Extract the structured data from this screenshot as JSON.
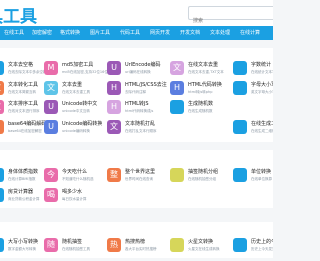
{
  "site": {
    "title": "具工具"
  },
  "search": {
    "placeholder": "搜索"
  },
  "nav": {
    "items": [
      "在线工具",
      "加密解密",
      "格式转换",
      "图片工具",
      "代码工具",
      "网页开发",
      "开发文档",
      "文本处理",
      "在线计算"
    ]
  },
  "sections": [
    {
      "title": "",
      "cards": [
        {
          "letter": "",
          "color": "#1ba0e2",
          "title": "文本去空格",
          "desc": "在线去除文本中多余空格"
        },
        {
          "letter": "M",
          "color": "#e96caa",
          "title": "md5加密工具",
          "desc": "md5在线加密,支持32位16位"
        },
        {
          "letter": "U",
          "color": "#9b59b6",
          "title": "UrlEncode编码",
          "desc": "url编码在线转换"
        },
        {
          "letter": "文",
          "color": "#d6a4e0",
          "title": "在线文本去重",
          "desc": "在线文本去重,TXT文本"
        },
        {
          "letter": "",
          "color": "#1ba0e2",
          "title": "字数统计",
          "desc": "在线统计文本字数"
        },
        {
          "letter": "文",
          "color": "#f07a48",
          "title": "文本转化工具",
          "desc": "在线文本简繁互转"
        },
        {
          "letter": "文",
          "color": "#5ec4e8",
          "title": "文本去重",
          "desc": "在线文本去重工具"
        },
        {
          "letter": "H",
          "color": "#9b59b6",
          "title": "HTML/JS/CSS去注",
          "desc": "去除代码注释"
        },
        {
          "letter": "H",
          "color": "#5b7ee0",
          "title": "HTML代码转换",
          "desc": "html转js转php"
        },
        {
          "letter": "",
          "color": "#1ba0e2",
          "title": "字母大小写转换",
          "desc": "英文字母大小写在线转换"
        },
        {
          "letter": "文",
          "color": "#e96caa",
          "title": "文本排序工具",
          "desc": "在线对文本进行排序"
        },
        {
          "letter": "U",
          "color": "#9b59b6",
          "title": "Unicode转中文",
          "desc": "unicode中文互转"
        },
        {
          "letter": "H",
          "color": "#d6a4e0",
          "title": "HTML转JS",
          "desc": "html代码转换成js"
        },
        {
          "letter": "",
          "color": "#1ba0e2",
          "title": "生成随机数",
          "desc": "在线生成随机数"
        },
        {
          "letter": "B",
          "color": "#f07a48",
          "title": "base64编码解码",
          "desc": "base64在线加密解密"
        },
        {
          "letter": "U",
          "color": "#5b7ee0",
          "title": "Unicode编码转换",
          "desc": "unicode编码转换"
        },
        {
          "letter": "文",
          "color": "#9b59b6",
          "title": "文本随机打乱",
          "desc": "在线打乱文本行顺序"
        },
        {
          "letter": "",
          "color": "#1ba0e2",
          "title": "在线生成二维码",
          "desc": "在线生成二维码图片"
        }
      ]
    },
    {
      "title": "",
      "cards": [
        {
          "letter": "",
          "color": "#1ba0e2",
          "title": "身体体质指数",
          "desc": "在线计算BMI指数"
        },
        {
          "letter": "今",
          "color": "#e96caa",
          "title": "今天吃什么",
          "desc": "不知道吃什么随机选"
        },
        {
          "letter": "整",
          "color": "#f07a48",
          "title": "整个世界这里",
          "desc": "世界时间在线查询"
        },
        {
          "letter": "",
          "color": "#d6d65a",
          "title": "抽签随机分组",
          "desc": "在线随机抽签分组"
        },
        {
          "letter": "",
          "color": "#1ba0e2",
          "title": "单位转换",
          "desc": "在线单位换算"
        },
        {
          "letter": "",
          "color": "#1ba0e2",
          "title": "房贷计算器",
          "desc": "商业贷款公积金计算"
        },
        {
          "letter": "喝",
          "color": "#e96caa",
          "title": "喝多少水",
          "desc": "每日饮水量计算"
        }
      ]
    },
    {
      "title": "",
      "cards": [
        {
          "letter": "",
          "color": "#1ba0e2",
          "title": "大写小写转换",
          "desc": "数字金额大写转换"
        },
        {
          "letter": "随",
          "color": "#e96caa",
          "title": "随机抽签",
          "desc": "在线随机抽签工具"
        },
        {
          "letter": "热",
          "color": "#f07a48",
          "title": "热搜热榜",
          "desc": "各大平台实时热搜榜"
        },
        {
          "letter": "",
          "color": "#d6d65a",
          "title": "火星文转换",
          "desc": "火星文在线生成转换"
        },
        {
          "letter": "",
          "color": "#1ba0e2",
          "title": "历史上的今天",
          "desc": "历史上今天发生了什么"
        }
      ]
    }
  ]
}
